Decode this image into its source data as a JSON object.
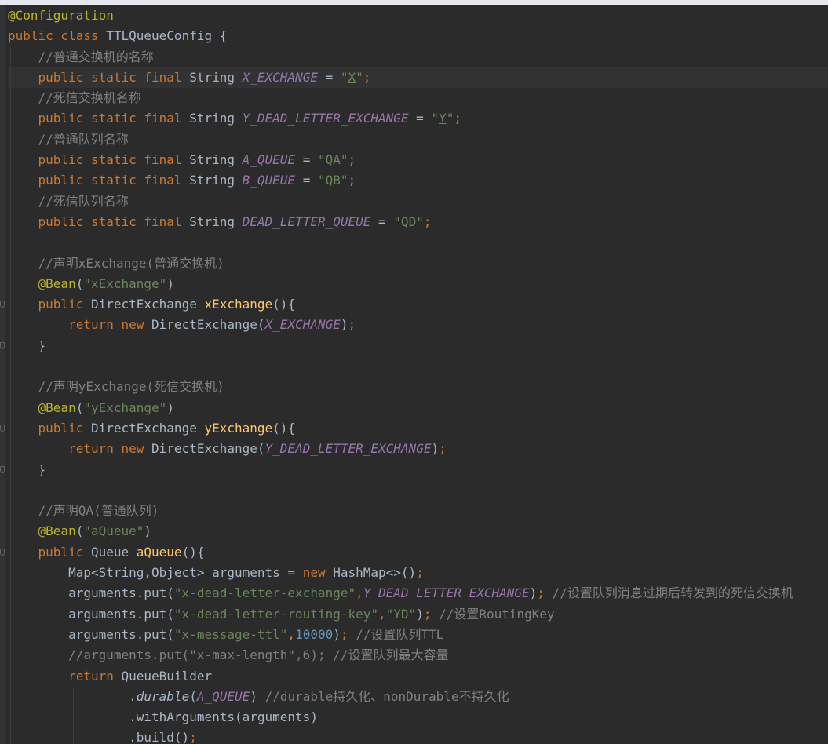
{
  "editor": {
    "lines": [
      [
        {
          "t": "@Configuration",
          "c": "ann"
        }
      ],
      [
        {
          "t": "public class ",
          "c": "kw"
        },
        {
          "t": "TTLQueueConfig {",
          "c": "plain"
        }
      ],
      [
        {
          "t": "    "
        },
        {
          "t": "//普通交换机的名称",
          "c": "cmt"
        }
      ],
      [
        {
          "t": "    "
        },
        {
          "t": "public static final ",
          "c": "kw"
        },
        {
          "t": "String ",
          "c": "plain"
        },
        {
          "t": "X_EXCHANGE",
          "c": "cst"
        },
        {
          "t": " = ",
          "c": "plain"
        },
        {
          "t": "\"",
          "c": "str"
        },
        {
          "t": "X",
          "c": "str ul"
        },
        {
          "t": "\"",
          "c": "str"
        },
        {
          "t": ";",
          "c": "kw"
        }
      ],
      [
        {
          "t": "    "
        },
        {
          "t": "//死信交换机名称",
          "c": "cmt"
        }
      ],
      [
        {
          "t": "    "
        },
        {
          "t": "public static final ",
          "c": "kw"
        },
        {
          "t": "String ",
          "c": "plain"
        },
        {
          "t": "Y_DEAD_LETTER_EXCHANGE",
          "c": "cst"
        },
        {
          "t": " = ",
          "c": "plain"
        },
        {
          "t": "\"",
          "c": "str"
        },
        {
          "t": "Y",
          "c": "str ul"
        },
        {
          "t": "\"",
          "c": "str"
        },
        {
          "t": ";",
          "c": "kw"
        }
      ],
      [
        {
          "t": "    "
        },
        {
          "t": "//普通队列名称",
          "c": "cmt"
        }
      ],
      [
        {
          "t": "    "
        },
        {
          "t": "public static final ",
          "c": "kw"
        },
        {
          "t": "String ",
          "c": "plain"
        },
        {
          "t": "A_QUEUE",
          "c": "cst"
        },
        {
          "t": " = ",
          "c": "plain"
        },
        {
          "t": "\"QA\"",
          "c": "str"
        },
        {
          "t": ";",
          "c": "kw"
        }
      ],
      [
        {
          "t": "    "
        },
        {
          "t": "public static final ",
          "c": "kw"
        },
        {
          "t": "String ",
          "c": "plain"
        },
        {
          "t": "B_QUEUE",
          "c": "cst"
        },
        {
          "t": " = ",
          "c": "plain"
        },
        {
          "t": "\"QB\"",
          "c": "str"
        },
        {
          "t": ";",
          "c": "kw"
        }
      ],
      [
        {
          "t": "    "
        },
        {
          "t": "//死信队列名称",
          "c": "cmt"
        }
      ],
      [
        {
          "t": "    "
        },
        {
          "t": "public static final ",
          "c": "kw"
        },
        {
          "t": "String ",
          "c": "plain"
        },
        {
          "t": "DEAD_LETTER_QUEUE",
          "c": "cst"
        },
        {
          "t": " = ",
          "c": "plain"
        },
        {
          "t": "\"QD\"",
          "c": "str"
        },
        {
          "t": ";",
          "c": "kw"
        }
      ],
      [],
      [
        {
          "t": "    "
        },
        {
          "t": "//声明xExchange(普通交换机)",
          "c": "cmt"
        }
      ],
      [
        {
          "t": "    "
        },
        {
          "t": "@Bean",
          "c": "ann"
        },
        {
          "t": "(",
          "c": "plain"
        },
        {
          "t": "\"xExchange\"",
          "c": "str"
        },
        {
          "t": ")",
          "c": "plain"
        }
      ],
      [
        {
          "t": "    "
        },
        {
          "t": "public ",
          "c": "kw"
        },
        {
          "t": "DirectExchange ",
          "c": "plain"
        },
        {
          "t": "xExchange",
          "c": "fn"
        },
        {
          "t": "(){",
          "c": "plain"
        }
      ],
      [
        {
          "t": "        "
        },
        {
          "t": "return new ",
          "c": "kw"
        },
        {
          "t": "DirectExchange(",
          "c": "plain"
        },
        {
          "t": "X_EXCHANGE",
          "c": "cst"
        },
        {
          "t": ")",
          "c": "plain"
        },
        {
          "t": ";",
          "c": "kw"
        }
      ],
      [
        {
          "t": "    "
        },
        {
          "t": "}",
          "c": "plain"
        }
      ],
      [],
      [
        {
          "t": "    "
        },
        {
          "t": "//声明yExchange(死信交换机)",
          "c": "cmt"
        }
      ],
      [
        {
          "t": "    "
        },
        {
          "t": "@Bean",
          "c": "ann"
        },
        {
          "t": "(",
          "c": "plain"
        },
        {
          "t": "\"yExchange\"",
          "c": "str"
        },
        {
          "t": ")",
          "c": "plain"
        }
      ],
      [
        {
          "t": "    "
        },
        {
          "t": "public ",
          "c": "kw"
        },
        {
          "t": "DirectExchange ",
          "c": "plain"
        },
        {
          "t": "yExchange",
          "c": "fn"
        },
        {
          "t": "(){",
          "c": "plain"
        }
      ],
      [
        {
          "t": "        "
        },
        {
          "t": "return new ",
          "c": "kw"
        },
        {
          "t": "DirectExchange(",
          "c": "plain"
        },
        {
          "t": "Y_DEAD_LETTER_EXCHANGE",
          "c": "cst"
        },
        {
          "t": ")",
          "c": "plain"
        },
        {
          "t": ";",
          "c": "kw"
        }
      ],
      [
        {
          "t": "    "
        },
        {
          "t": "}",
          "c": "plain"
        }
      ],
      [],
      [
        {
          "t": "    "
        },
        {
          "t": "//声明QA(普通队列)",
          "c": "cmt"
        }
      ],
      [
        {
          "t": "    "
        },
        {
          "t": "@Bean",
          "c": "ann"
        },
        {
          "t": "(",
          "c": "plain"
        },
        {
          "t": "\"aQueue\"",
          "c": "str"
        },
        {
          "t": ")",
          "c": "plain"
        }
      ],
      [
        {
          "t": "    "
        },
        {
          "t": "public ",
          "c": "kw"
        },
        {
          "t": "Queue ",
          "c": "plain"
        },
        {
          "t": "aQueue",
          "c": "fn"
        },
        {
          "t": "(){",
          "c": "plain"
        }
      ],
      [
        {
          "t": "        "
        },
        {
          "t": "Map<String,Object> arguments = ",
          "c": "plain"
        },
        {
          "t": "new ",
          "c": "kw"
        },
        {
          "t": "HashMap<>()",
          "c": "plain"
        },
        {
          "t": ";",
          "c": "kw"
        }
      ],
      [
        {
          "t": "        "
        },
        {
          "t": "arguments.put(",
          "c": "plain"
        },
        {
          "t": "\"x-dead-letter-exchange\"",
          "c": "str"
        },
        {
          "t": ",",
          "c": "kw"
        },
        {
          "t": "Y_DEAD_LETTER_EXCHANGE",
          "c": "cst"
        },
        {
          "t": ")",
          "c": "plain"
        },
        {
          "t": "; ",
          "c": "kw"
        },
        {
          "t": "//设置队列消息过期后转发到的死信交换机",
          "c": "cmt"
        }
      ],
      [
        {
          "t": "        "
        },
        {
          "t": "arguments.put(",
          "c": "plain"
        },
        {
          "t": "\"x-dead-letter-routing-key\"",
          "c": "str"
        },
        {
          "t": ",",
          "c": "kw"
        },
        {
          "t": "\"YD\"",
          "c": "str"
        },
        {
          "t": ")",
          "c": "plain"
        },
        {
          "t": "; ",
          "c": "kw"
        },
        {
          "t": "//设置RoutingKey",
          "c": "cmt"
        }
      ],
      [
        {
          "t": "        "
        },
        {
          "t": "arguments.put(",
          "c": "plain"
        },
        {
          "t": "\"x-message-ttl\"",
          "c": "str"
        },
        {
          "t": ",",
          "c": "kw"
        },
        {
          "t": "10000",
          "c": "num"
        },
        {
          "t": ")",
          "c": "plain"
        },
        {
          "t": "; ",
          "c": "kw"
        },
        {
          "t": "//设置队列TTL",
          "c": "cmt"
        }
      ],
      [
        {
          "t": "        "
        },
        {
          "t": "//arguments.put(\"x-max-length\",6); //设置队列最大容量",
          "c": "cmt"
        }
      ],
      [
        {
          "t": "        "
        },
        {
          "t": "return ",
          "c": "kw"
        },
        {
          "t": "QueueBuilder",
          "c": "plain"
        }
      ],
      [
        {
          "t": "                "
        },
        {
          "t": ".",
          "c": "plain"
        },
        {
          "t": "durable",
          "c": "ital"
        },
        {
          "t": "(",
          "c": "plain"
        },
        {
          "t": "A_QUEUE",
          "c": "cst"
        },
        {
          "t": ") ",
          "c": "plain"
        },
        {
          "t": "//durable持久化、nonDurable不持久化",
          "c": "cmt"
        }
      ],
      [
        {
          "t": "                "
        },
        {
          "t": ".withArguments(arguments)",
          "c": "plain"
        }
      ],
      [
        {
          "t": "                "
        },
        {
          "t": ".build()",
          "c": "plain"
        },
        {
          "t": ";",
          "c": "kw"
        }
      ]
    ]
  }
}
